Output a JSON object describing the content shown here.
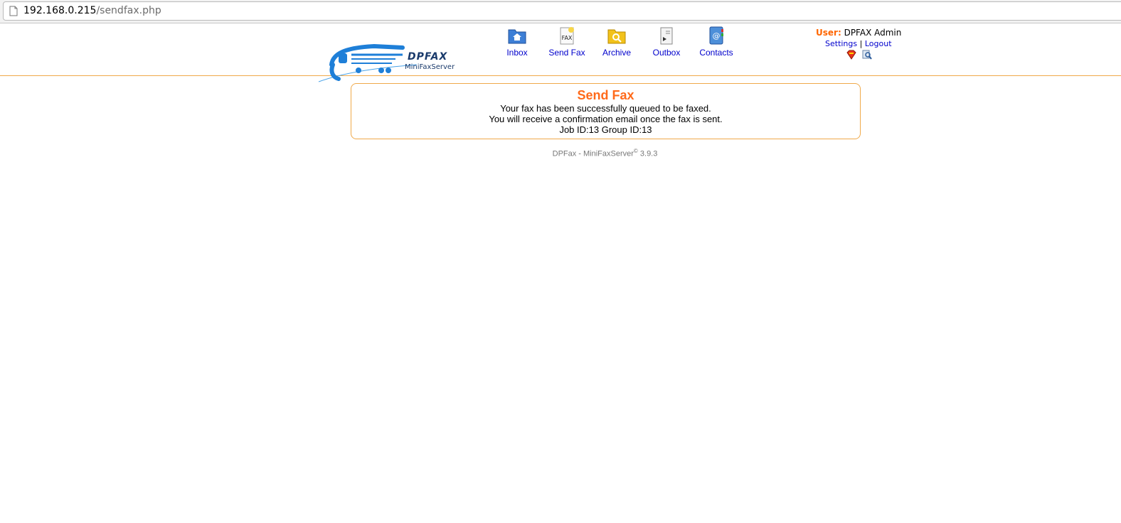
{
  "browser": {
    "url_host": "192.168.0.215",
    "url_path": "/sendfax.php"
  },
  "logo": {
    "name": "DPFAX",
    "subtitle": "MiniFaxServer"
  },
  "nav": [
    {
      "label": "Inbox",
      "icon": "inbox-folder-icon"
    },
    {
      "label": "Send Fax",
      "icon": "send-fax-icon"
    },
    {
      "label": "Archive",
      "icon": "archive-folder-icon"
    },
    {
      "label": "Outbox",
      "icon": "outbox-icon"
    },
    {
      "label": "Contacts",
      "icon": "contacts-book-icon"
    }
  ],
  "user": {
    "label": "User:",
    "name": "DPFAX Admin",
    "settings": "Settings",
    "separator": "|",
    "logout": "Logout"
  },
  "message": {
    "title": "Send Fax",
    "line1": "Your fax has been successfully queued to be faxed.",
    "line2": "You will receive a confirmation email once the fax is sent.",
    "line3": "Job ID:13 Group ID:13"
  },
  "footer": {
    "product": "DPFax - MiniFaxServer",
    "mark": "©",
    "version": "3.9.3"
  },
  "colors": {
    "accent": "#ff6a1a",
    "border": "#f0a94a",
    "link": "#0000cc"
  }
}
